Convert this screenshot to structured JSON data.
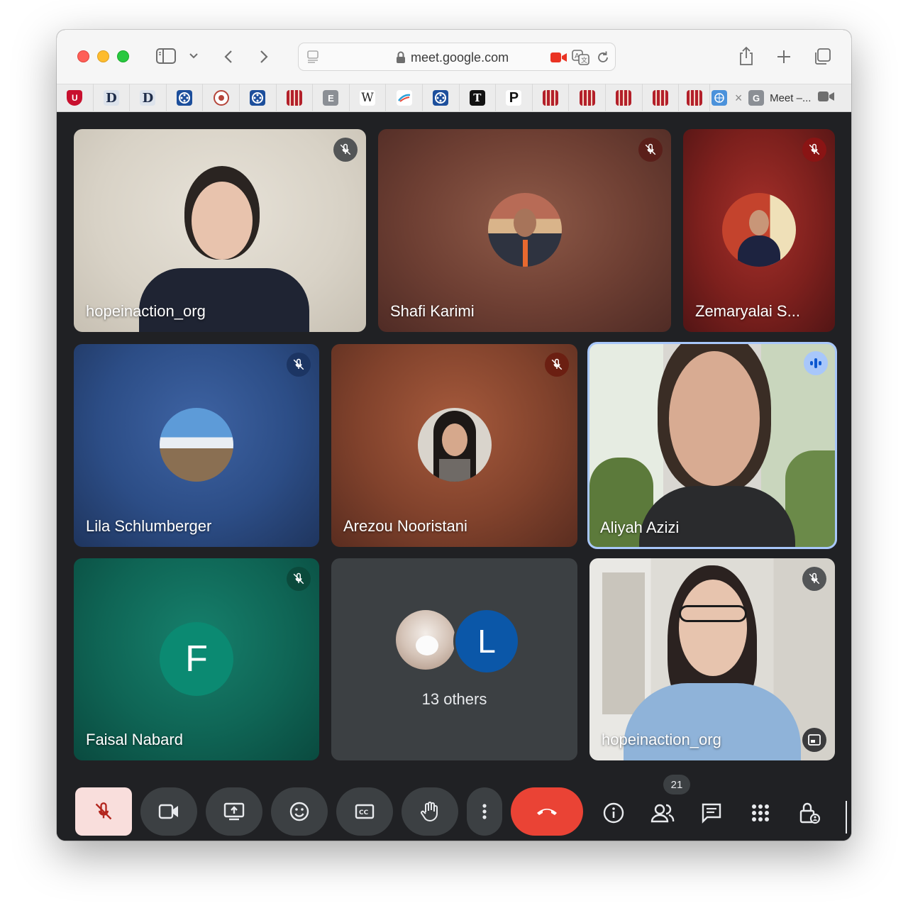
{
  "browser": {
    "url": "meet.google.com",
    "active_tab_label": "Meet –...",
    "bookmarks": [
      "shield-logo",
      "D",
      "D",
      "reel",
      "seal",
      "reel",
      "pattern",
      "E",
      "W",
      "swoosh",
      "reel",
      "T",
      "P",
      "pattern",
      "pattern",
      "pattern",
      "pattern",
      "pattern",
      "un-emblem"
    ]
  },
  "tiles": [
    {
      "name": "hopeinaction_org",
      "mic": "muted"
    },
    {
      "name": "Shafi Karimi",
      "mic": "muted"
    },
    {
      "name": "Zemaryalai S...",
      "mic": "muted"
    },
    {
      "name": "Lila Schlumberger",
      "mic": "muted"
    },
    {
      "name": "Arezou Nooristani",
      "mic": "muted"
    },
    {
      "name": "Aliyah Azizi",
      "mic": "speaking"
    },
    {
      "name": "Faisal Nabard",
      "mic": "muted",
      "initial": "F"
    },
    {
      "others_label": "13 others",
      "initial": "L"
    },
    {
      "name": "hopeinaction_org",
      "mic": "muted"
    }
  ],
  "controls": {
    "participant_count": "21",
    "end_call_color": "#ea4335",
    "mic_off_bg": "#f9dedc"
  }
}
